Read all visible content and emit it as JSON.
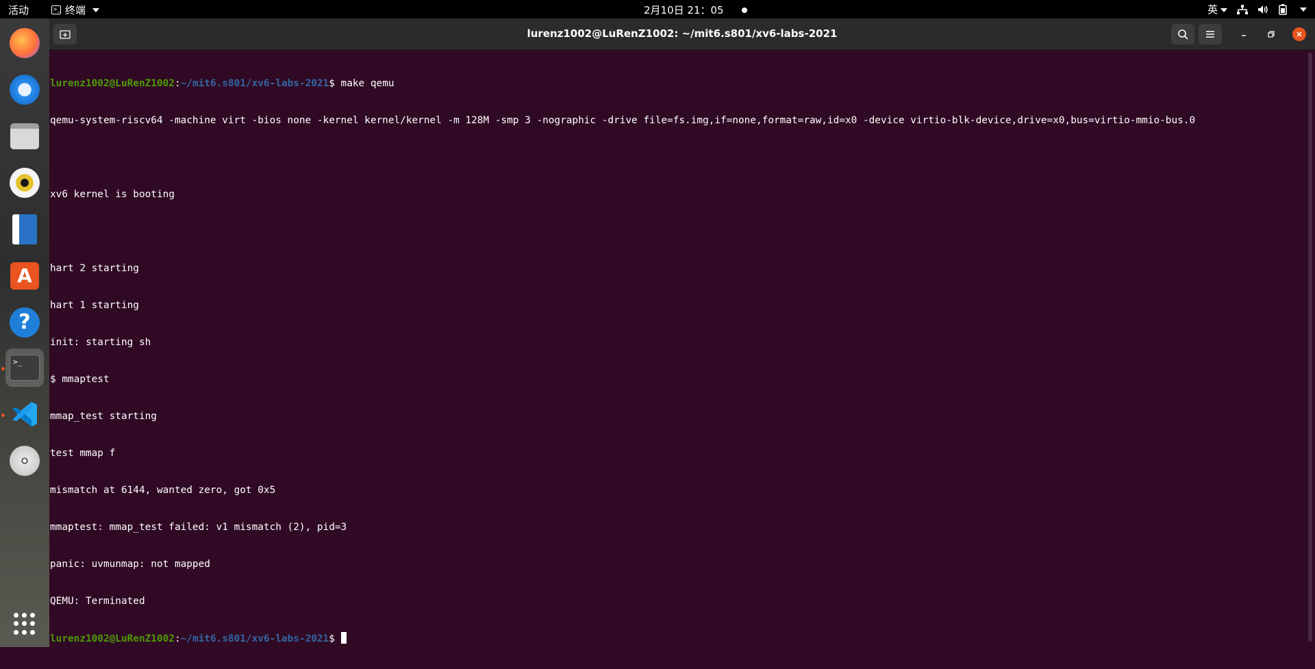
{
  "topbar": {
    "activities": "活动",
    "app_menu": "终端",
    "clock": "2月10日  21：05",
    "input_method": "英"
  },
  "dock": {
    "items": [
      {
        "name": "firefox-icon",
        "color": "#ff7139"
      },
      {
        "name": "thunderbird-icon",
        "color": "#2a8ff0"
      },
      {
        "name": "files-icon",
        "color": "#9e9e9e"
      },
      {
        "name": "rhythmbox-icon",
        "color": "#e6c229"
      },
      {
        "name": "libreoffice-writer-icon",
        "color": "#2a72c6"
      },
      {
        "name": "ubuntu-software-icon",
        "color": "#e95420"
      },
      {
        "name": "help-icon",
        "color": "#1f7fd8"
      },
      {
        "name": "terminal-icon",
        "color": "#3c3c3c"
      },
      {
        "name": "vscode-icon",
        "color": "#23a9f2"
      },
      {
        "name": "dvd-icon",
        "color": "#d6d6d6"
      }
    ],
    "terminal_glyph": ">_"
  },
  "window": {
    "title": "lurenz1002@LuRenZ1002: ~/mit6.s801/xv6-labs-2021"
  },
  "terminal": {
    "prompt_user": "lurenz1002@LuRenZ1002",
    "prompt_path": "~/mit6.s801/xv6-labs-2021",
    "command": "$ make qemu",
    "output": [
      "qemu-system-riscv64 -machine virt -bios none -kernel kernel/kernel -m 128M -smp 3 -nographic -drive file=fs.img,if=none,format=raw,id=x0 -device virtio-blk-device,drive=x0,bus=virtio-mmio-bus.0",
      "",
      "xv6 kernel is booting",
      "",
      "hart 2 starting",
      "hart 1 starting",
      "init: starting sh",
      "$ mmaptest",
      "mmap_test starting",
      "test mmap f",
      "mismatch at 6144, wanted zero, got 0x5",
      "mmaptest: mmap_test failed: v1 mismatch (2), pid=3",
      "panic: uvmunmap: not mapped",
      "QEMU: Terminated"
    ],
    "final_prompt_suffix": "$ "
  },
  "colors": {
    "terminal_bg": "#300a24",
    "prompt_user": "#4e9a06",
    "prompt_path": "#3465a4",
    "accent": "#e95420"
  }
}
